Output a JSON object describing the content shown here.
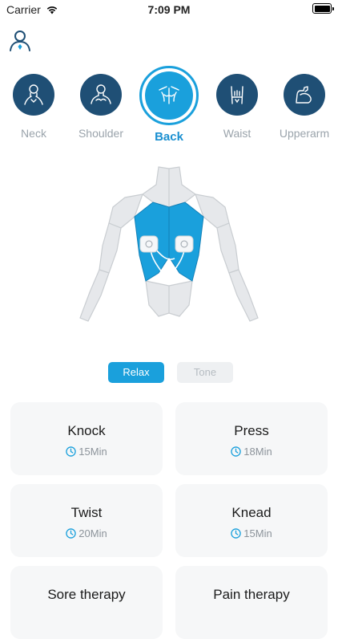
{
  "status_bar": {
    "carrier": "Carrier",
    "time": "7:09 PM"
  },
  "header": {
    "profile_icon": "user-profile-icon"
  },
  "body_parts": [
    {
      "label": "Neck",
      "icon": "neck-icon",
      "active": false
    },
    {
      "label": "Shoulder",
      "icon": "shoulder-icon",
      "active": false
    },
    {
      "label": "Back",
      "icon": "back-icon",
      "active": true
    },
    {
      "label": "Waist",
      "icon": "waist-icon",
      "active": false
    },
    {
      "label": "Upperarm",
      "icon": "upperarm-icon",
      "active": false
    }
  ],
  "modes": {
    "relax": "Relax",
    "tone": "Tone",
    "selected": "Relax"
  },
  "programs": [
    {
      "name": "Knock",
      "duration": "15Min"
    },
    {
      "name": "Press",
      "duration": "18Min"
    },
    {
      "name": "Twist",
      "duration": "20Min"
    },
    {
      "name": "Knead",
      "duration": "15Min"
    },
    {
      "name": "Sore therapy",
      "duration": ""
    },
    {
      "name": "Pain therapy",
      "duration": ""
    }
  ],
  "colors": {
    "accent": "#1aa0dc",
    "dark_circle": "#1f4f75",
    "card_bg": "#f6f7f8"
  }
}
